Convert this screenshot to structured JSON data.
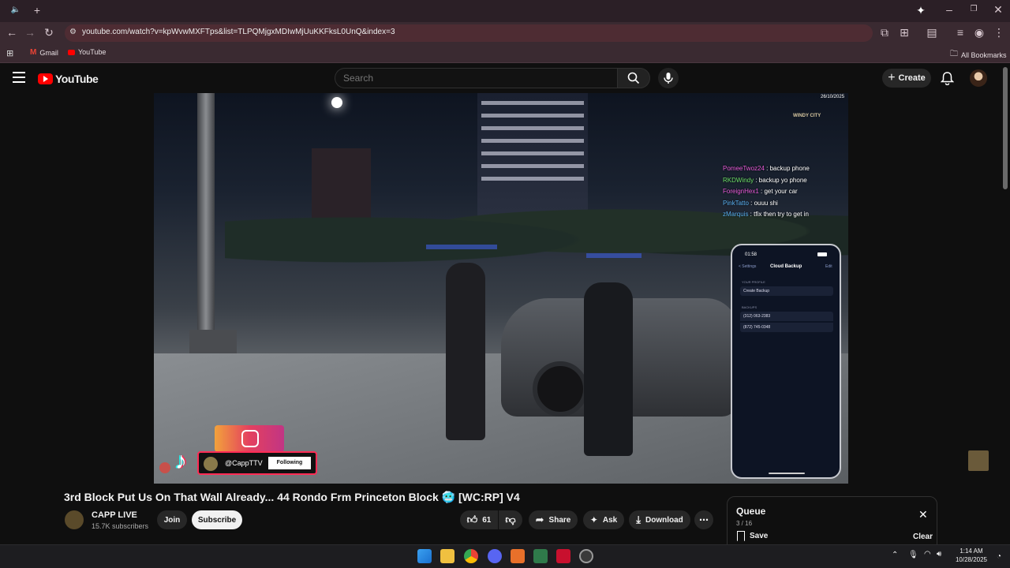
{
  "browser": {
    "url": "youtube.com/watch?v=kpWvwMXFTps&list=TLPQMjgxMDIwMjUuKKFksL0UnQ&index=3",
    "bookmarks": [
      {
        "label": "Gmail"
      },
      {
        "label": "YouTube"
      }
    ],
    "all_bookmarks_label": "All Bookmarks"
  },
  "youtube": {
    "logo_text": "YouTube",
    "search_placeholder": "Search",
    "create_label": "Create"
  },
  "video": {
    "overlay": {
      "date": "26/10/2025",
      "server_logo": "WINDY CITY",
      "chat": [
        {
          "user": "PomeeTwoz24",
          "text": " : backup phone",
          "color": "#e85bd8"
        },
        {
          "user": "RKDWindy",
          "text": " : backup yo phone",
          "color": "#6ee06a"
        },
        {
          "user": "ForeignHex1",
          "text": " : get your car",
          "color": "#e85bd8"
        },
        {
          "user": "PinkTatto",
          "text": " : ouuu shi",
          "color": "#5ab0f0"
        },
        {
          "user": "zMarquis",
          "text": " : tfix then try to get in",
          "color": "#5ab0f0"
        }
      ],
      "phone": {
        "time": "01:58",
        "back_label": "< Settings",
        "screen_title": "Cloud Backup",
        "edit_label": "Edit",
        "section_profile": "YOUR PROFILE",
        "create_backup": "Create Backup",
        "section_backups": "BACKUPS",
        "numbers": [
          "(312) 063-2383",
          "(872) 745-0348"
        ]
      },
      "tiktok_handle": "@CappTTV",
      "following_label": "Following"
    }
  },
  "watch": {
    "title": "3rd Block Put Us On That Wall Already... 44 Rondo Frm Princeton Block 🥶 [WC:RP] V4",
    "channel_name": "CAPP LIVE",
    "subscribers": "15.7K subscribers",
    "join_label": "Join",
    "subscribe_label": "Subscribe",
    "likes": "61",
    "share_label": "Share",
    "ask_label": "Ask",
    "download_label": "Download"
  },
  "queue": {
    "title": "Queue",
    "position": "3 / 16",
    "save_label": "Save",
    "clear_label": "Clear"
  },
  "taskbar": {
    "time": "1:14 AM",
    "date": "10/28/2025"
  },
  "colors": {
    "yt_red": "#ff0000",
    "subscribe_bg": "#f1f1f1"
  }
}
